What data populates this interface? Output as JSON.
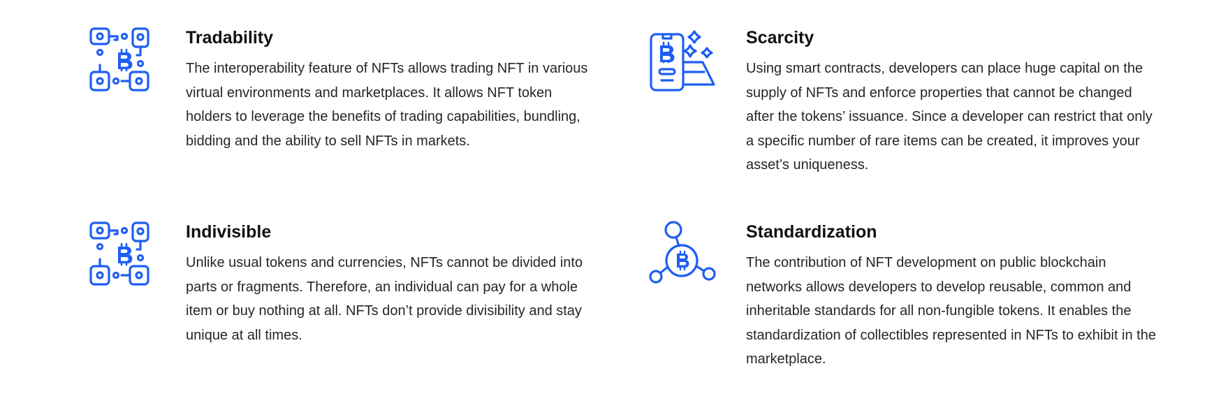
{
  "accent_color": "#1e5ef3",
  "features": [
    {
      "icon": "blockchain-network-icon",
      "title": "Tradability",
      "description": "The interoperability feature of NFTs allows trading NFT in various virtual environments and marketplaces. It allows NFT token holders to leverage the benefits of trading capabilities, bundling, bidding and the ability to sell NFTs in markets."
    },
    {
      "icon": "mobile-crypto-wallet-icon",
      "title": "Scarcity",
      "description": "Using smart contracts, developers can place huge capital on the supply of NFTs and enforce properties that cannot be changed after the tokens’ issuance. Since a developer can restrict that only a specific number of rare items can be created, it improves your asset’s uniqueness."
    },
    {
      "icon": "blockchain-network-icon",
      "title": "Indivisible",
      "description": "Unlike usual tokens and currencies, NFTs cannot be divided into parts or fragments. Therefore, an individual can pay for a whole item or buy nothing at all. NFTs don’t provide divisibility and stay unique at all times."
    },
    {
      "icon": "crypto-hub-network-icon",
      "title": "Standardization",
      "description": "The contribution of NFT development on public blockchain networks allows developers to develop reusable, common and inheritable standards for all non-fungible tokens. It enables the standardization of collectibles represented in NFTs to exhibit in the marketplace."
    }
  ]
}
